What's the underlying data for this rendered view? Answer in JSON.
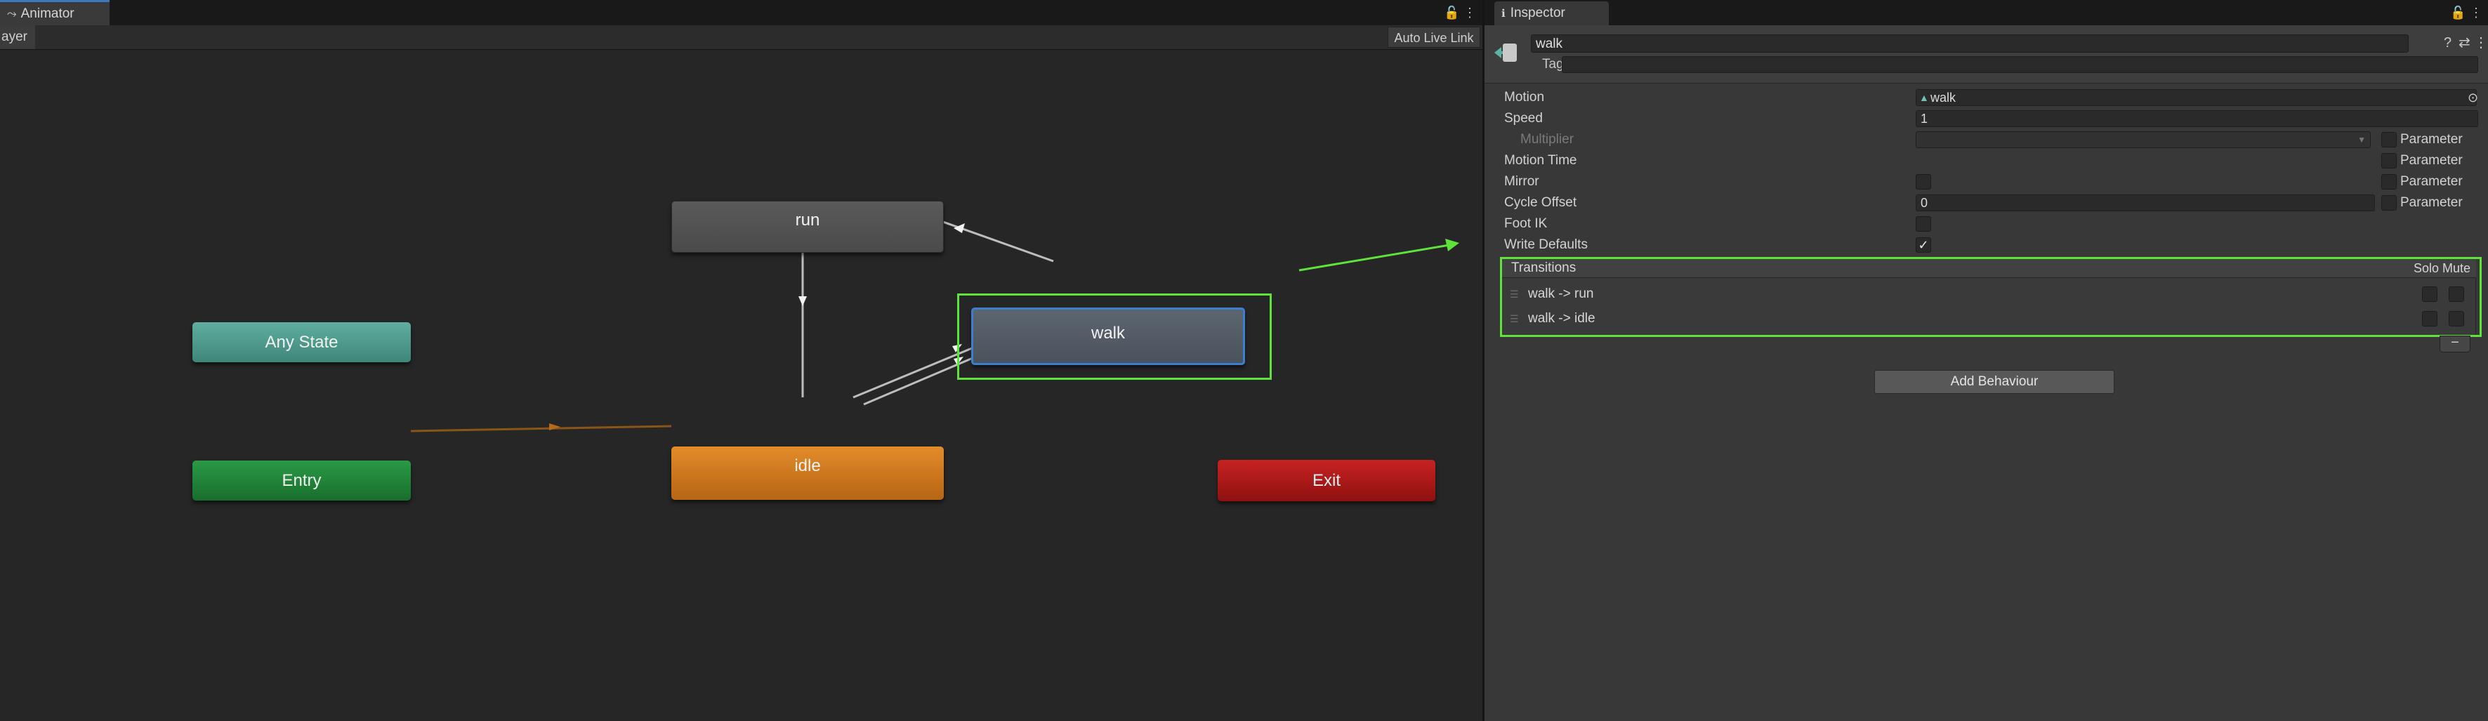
{
  "animator": {
    "tab_label": "Animator",
    "tab_icon": "animator-icon",
    "layer_crumb": "ayer",
    "auto_live_link": "Auto Live Link",
    "states": {
      "run": "run",
      "walk": "walk",
      "any_state": "Any State",
      "entry": "Entry",
      "idle": "idle",
      "exit": "Exit"
    },
    "colors": {
      "highlight": "#5fe33b",
      "selected_border": "#3b7fd3",
      "entry_transition": "#a86514",
      "transition": "#bdbdbd"
    }
  },
  "inspector": {
    "tab_label": "Inspector",
    "tab_icon": "info-icon",
    "state_name": "walk",
    "tag_label": "Tag",
    "properties": {
      "motion_label": "Motion",
      "motion_value": "walk",
      "speed_label": "Speed",
      "speed_value": "1",
      "multiplier_label": "Multiplier",
      "motion_time_label": "Motion Time",
      "mirror_label": "Mirror",
      "cycle_offset_label": "Cycle Offset",
      "cycle_offset_value": "0",
      "foot_ik_label": "Foot IK",
      "write_defaults_label": "Write Defaults",
      "write_defaults_checked": true,
      "parameter_label": "Parameter"
    },
    "transitions": {
      "header": "Transitions",
      "solo_label": "Solo",
      "mute_label": "Mute",
      "items": [
        {
          "label": "walk -> run"
        },
        {
          "label": "walk -> idle"
        }
      ]
    },
    "minus_label": "−",
    "add_behaviour": "Add Behaviour"
  }
}
